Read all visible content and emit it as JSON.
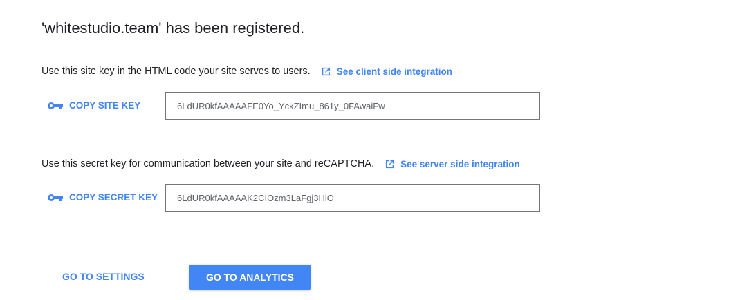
{
  "title": "'whitestudio.team' has been registered.",
  "site_key": {
    "description": "Use this site key in the HTML code your site serves to users.",
    "link": "See client side integration",
    "copy_label": "COPY SITE KEY",
    "value": "6LdUR0kfAAAAAFE0Yo_YckZImu_861y_0FAwaiFw"
  },
  "secret_key": {
    "description": "Use this secret key for communication between your site and reCAPTCHA.",
    "link": "See server side integration",
    "copy_label": "COPY SECRET KEY",
    "value": "6LdUR0kfAAAAAK2CIOzm3LaFgj3HiO"
  },
  "actions": {
    "settings": "GO TO SETTINGS",
    "analytics": "GO TO ANALYTICS"
  },
  "colors": {
    "accent": "#4285f4"
  }
}
